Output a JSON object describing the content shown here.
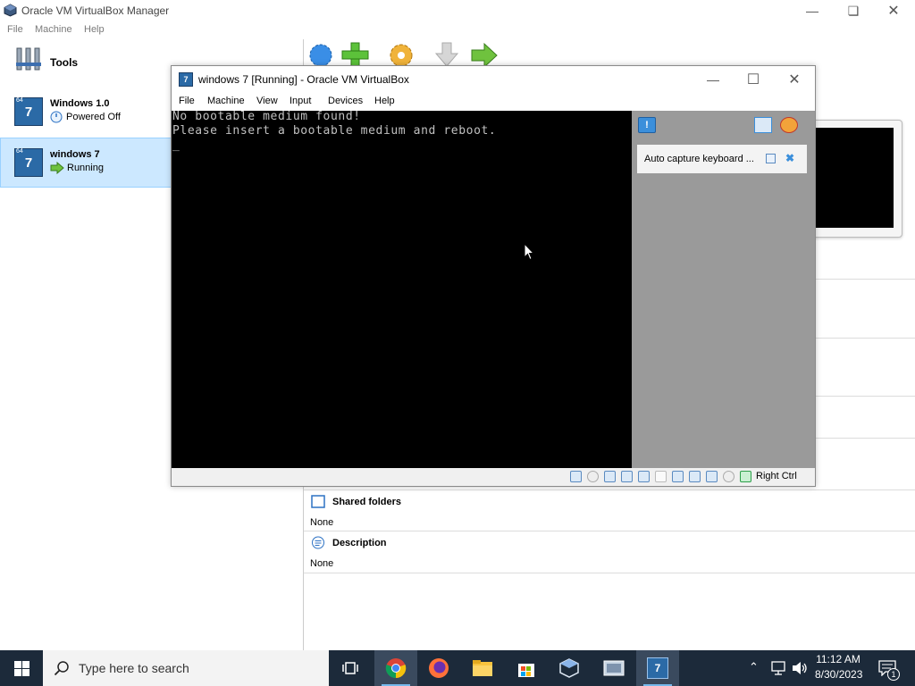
{
  "manager": {
    "title": "Oracle VM VirtualBox Manager",
    "menu": [
      "File",
      "Machine",
      "Help"
    ],
    "tools_label": "Tools",
    "vms": [
      {
        "name": "Windows 1.0",
        "state": "Powered Off",
        "badge": "64"
      },
      {
        "name": "windows 7",
        "state": "Running",
        "badge": "64"
      }
    ],
    "sections": [
      {
        "title": "Shared folders",
        "value": "None"
      },
      {
        "title": "Description",
        "value": "None"
      }
    ]
  },
  "vm_window": {
    "title": "windows 7 [Running] - Oracle VM VirtualBox",
    "menu": [
      "File",
      "Machine",
      "View",
      "Input",
      "Devices",
      "Help"
    ],
    "console_lines": [
      "No bootable medium found!",
      "Please insert a bootable medium and reboot.",
      "_"
    ],
    "notification": "Auto capture keyboard ...",
    "host_key": "Right Ctrl"
  },
  "taskbar": {
    "search_placeholder": "Type here to search",
    "time": "11:12 AM",
    "date": "8/30/2023",
    "notification_count": "1"
  },
  "colors": {
    "selection": "#cce8ff",
    "taskbar": "#1c2a3a",
    "console_bg": "#000000",
    "console_text": "#c0c0c0",
    "notification_pane": "#9a9a9a"
  }
}
